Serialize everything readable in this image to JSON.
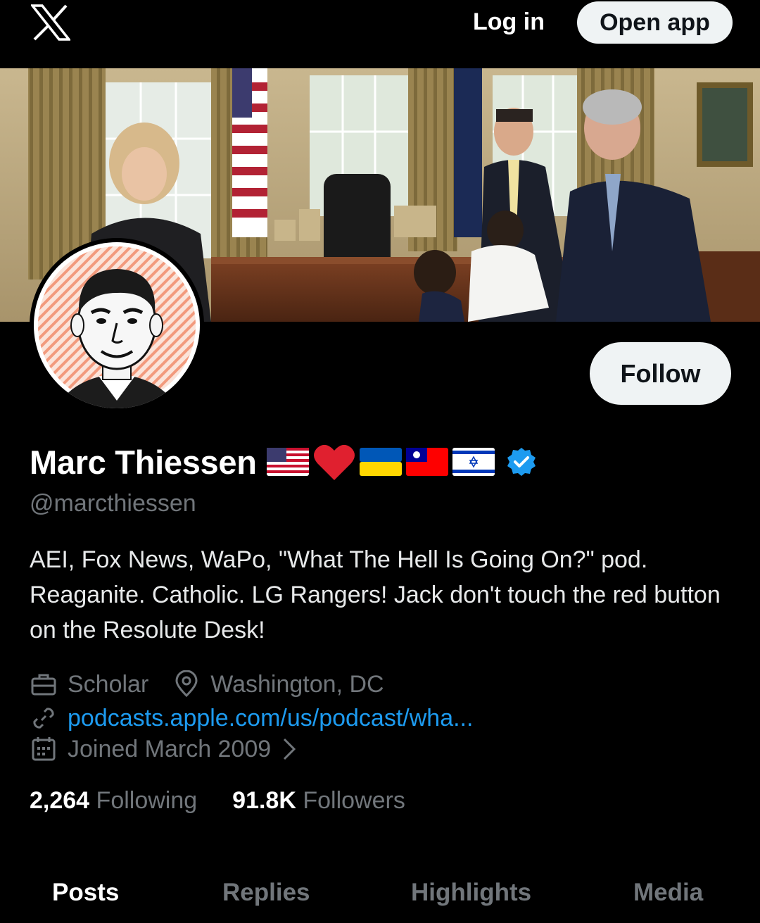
{
  "topbar": {
    "login_label": "Log in",
    "open_app_label": "Open app"
  },
  "profile": {
    "name": "Marc Thiessen",
    "flags": [
      "us-flag-icon",
      "red-heart-icon",
      "ukraine-flag-icon",
      "taiwan-flag-icon",
      "israel-flag-icon",
      "verified-badge-icon"
    ],
    "handle": "@marcthiessen",
    "bio": "AEI, Fox News, WaPo, \"What The Hell Is Going On?\" pod. Reaganite. Catholic. LG Rangers! Jack don't touch the red button on the Resolute Desk!",
    "follow_label": "Follow",
    "profession": "Scholar",
    "location": "Washington, DC",
    "link": "podcasts.apple.com/us/podcast/wha...",
    "joined": "Joined March 2009",
    "following_count": "2,264",
    "following_label": "Following",
    "followers_count": "91.8K",
    "followers_label": "Followers"
  },
  "tabs": [
    {
      "label": "Posts"
    },
    {
      "label": "Replies"
    },
    {
      "label": "Highlights"
    },
    {
      "label": "Media"
    }
  ],
  "colors": {
    "background": "#000000",
    "link": "#1d9bf0",
    "muted": "#71767b",
    "verified": "#1d9bf0"
  }
}
